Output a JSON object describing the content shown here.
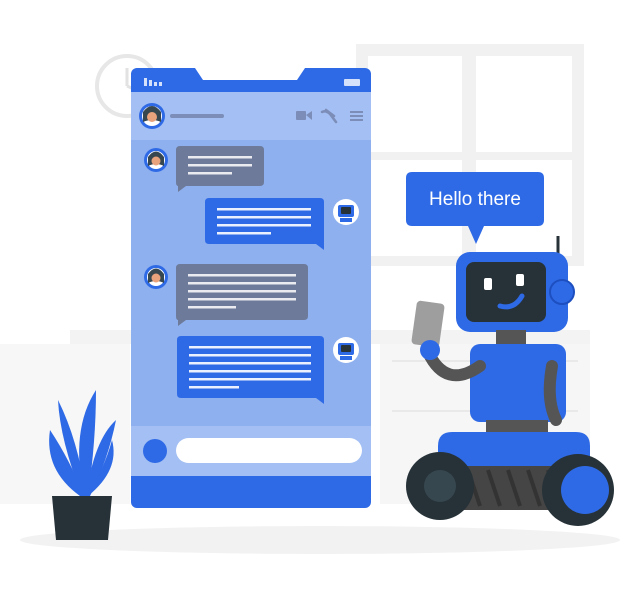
{
  "illustration": {
    "speech_bubble": {
      "text": "Hello there"
    }
  },
  "colors": {
    "accent_blue": "#2f6ae6",
    "phone_screen": "#8fb0ef",
    "chat_bubble_gray": "#6d7a9a",
    "robot_dark": "#3a3a3a",
    "plant_pot": "#263238"
  },
  "icons": [
    "clock-icon",
    "signal-icon",
    "battery-icon",
    "video-call-icon",
    "phone-call-icon",
    "menu-icon",
    "avatar",
    "bot-avatar"
  ]
}
